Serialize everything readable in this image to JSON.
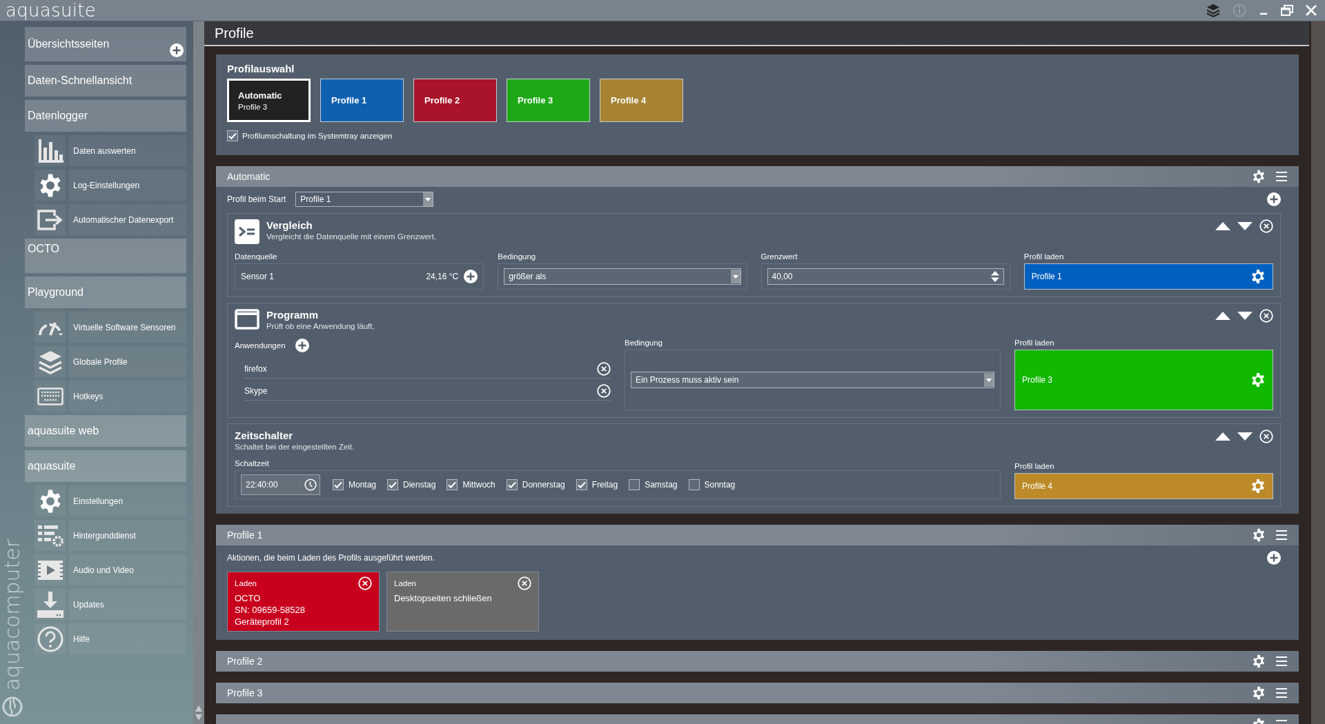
{
  "window": {
    "title": "aquasuite",
    "brand": "aquacomputer"
  },
  "sidebar": {
    "sections": [
      {
        "label": "Übersichtsseiten",
        "add": true
      },
      {
        "label": "Daten-Schnellansicht"
      },
      {
        "label": "Datenlogger",
        "children": [
          {
            "label": "Daten auswerten"
          },
          {
            "label": "Log-Einstellungen"
          },
          {
            "label": "Automatischer Datenexport"
          }
        ]
      },
      {
        "label": "OCTO"
      },
      {
        "label": "Playground",
        "children": [
          {
            "label": "Virtuelle Software Sensoren"
          },
          {
            "label": "Globale Profile"
          },
          {
            "label": "Hotkeys"
          }
        ]
      },
      {
        "label": "aquasuite web"
      },
      {
        "label": "aquasuite",
        "children": [
          {
            "label": "Einstellungen"
          },
          {
            "label": "Hintergunddienst"
          },
          {
            "label": "Audio und Video"
          },
          {
            "label": "Updates"
          },
          {
            "label": "Hilfe"
          }
        ]
      }
    ]
  },
  "page": {
    "title": "Profile"
  },
  "profile_selection": {
    "title": "Profilauswahl",
    "tiles": [
      {
        "label": "Automatic",
        "sublabel": "Profile 3",
        "color": "#222222",
        "selected": true
      },
      {
        "label": "Profile 1",
        "color": "#1060b0",
        "selected": false
      },
      {
        "label": "Profile 2",
        "color": "#a8122a",
        "selected": false
      },
      {
        "label": "Profile 3",
        "color": "#1ea818",
        "selected": false
      },
      {
        "label": "Profile 4",
        "color": "#a68232",
        "selected": false
      }
    ],
    "tray_option": {
      "label": "Profilumschaltung im Systemtray anzeigen",
      "checked": true
    }
  },
  "automatic": {
    "title": "Automatic",
    "start_label": "Profil beim Start",
    "start_value": "Profile 1",
    "rules": [
      {
        "kind": "compare",
        "title": "Vergleich",
        "description": "Vergleicht die Datenquelle mit einem Grenzwert.",
        "source_label": "Datenquelle",
        "source": "Sensor 1",
        "reading": "24,16 °C",
        "condition_label": "Bedingung",
        "condition": "größer als",
        "threshold_label": "Grenzwert",
        "threshold": "40,00",
        "load_label": "Profil laden",
        "load": "Profile 1",
        "color": "#0060c0"
      },
      {
        "kind": "program",
        "title": "Programm",
        "description": "Prüft ob eine Anwendung läuft.",
        "apps_label": "Anwendungen",
        "apps": [
          "firefox",
          "Skype"
        ],
        "condition_label": "Bedingung",
        "condition": "Ein Prozess muss aktiv sein",
        "load_label": "Profil laden",
        "load": "Profile 3",
        "color": "#10b800"
      },
      {
        "kind": "timer",
        "title": "Zeitschalter",
        "description": "Schaltet bei der eingestellten Zeit.",
        "time_label": "Schaltzeit",
        "time": "22:40:00",
        "days": [
          {
            "label": "Montag",
            "checked": true
          },
          {
            "label": "Dienstag",
            "checked": true
          },
          {
            "label": "Mittwoch",
            "checked": true
          },
          {
            "label": "Donnerstag",
            "checked": true
          },
          {
            "label": "Freitag",
            "checked": true
          },
          {
            "label": "Samstag",
            "checked": false
          },
          {
            "label": "Sonntag",
            "checked": false
          }
        ],
        "load_label": "Profil laden",
        "load": "Profile 4",
        "color": "#bc8a28"
      }
    ]
  },
  "profiles": [
    {
      "title": "Profile 1",
      "description": "Aktionen, die beim Laden des Profils ausgeführt werden.",
      "actions": [
        {
          "title": "Laden",
          "lines": [
            "OCTO",
            "SN: 09659-58528",
            "Geräteprofil 2"
          ],
          "color": "#c8001e"
        },
        {
          "title": "Laden",
          "lines": [
            "Desktopseiten schließen"
          ],
          "color": "#6a6a6a"
        }
      ]
    },
    {
      "title": "Profile 2"
    },
    {
      "title": "Profile 3"
    }
  ],
  "next_section_peek": true
}
